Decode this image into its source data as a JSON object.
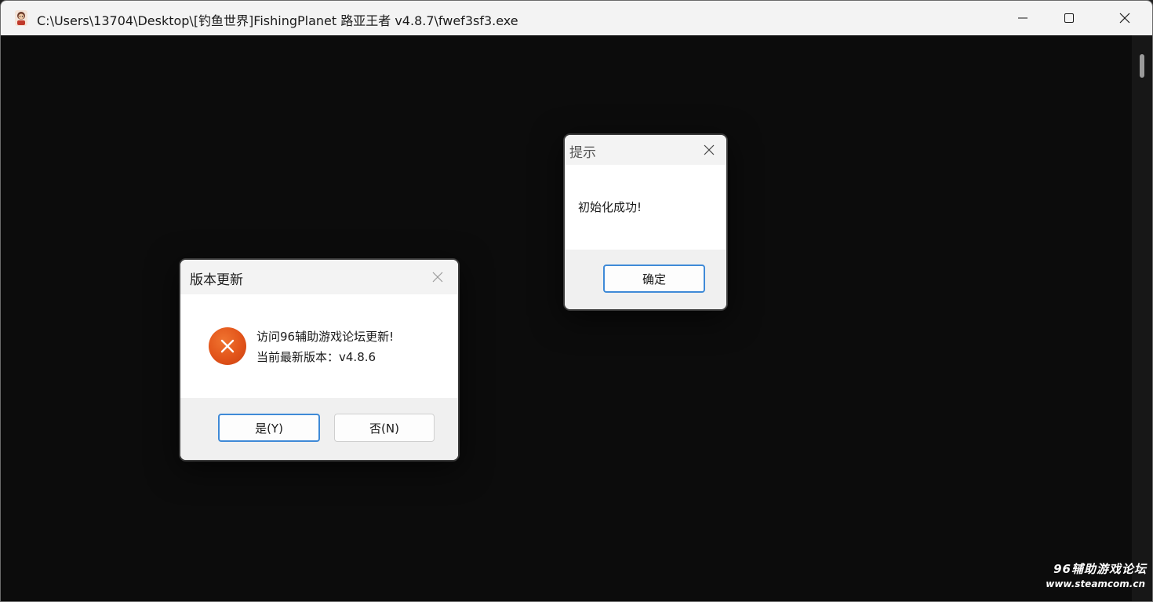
{
  "window": {
    "title": "C:\\Users\\13704\\Desktop\\[钓鱼世界]FishingPlanet 路亚王者 v4.8.7\\fwef3sf3.exe",
    "app_icon": "fish-app-icon"
  },
  "controls": {
    "minimize_icon": "minimize-icon",
    "maximize_icon": "maximize-icon",
    "close_icon": "close-icon"
  },
  "update_dialog": {
    "title": "版本更新",
    "line1": "访问96辅助游戏论坛更新!",
    "line2": "当前最新版本：v4.8.6",
    "yes_label": "是(Y)",
    "no_label": "否(N)",
    "icon": "error-icon"
  },
  "info_dialog": {
    "title": "提示",
    "message": "初始化成功!",
    "ok_label": "确定"
  },
  "watermark": {
    "line1": "96辅助游戏论坛",
    "line2": "www.steamcom.cn"
  },
  "colors": {
    "console_bg": "#0c0c0c",
    "titlebar_bg": "#f3f3f3",
    "default_button_border": "#3f8ad7",
    "error_icon": "#e2541a"
  }
}
